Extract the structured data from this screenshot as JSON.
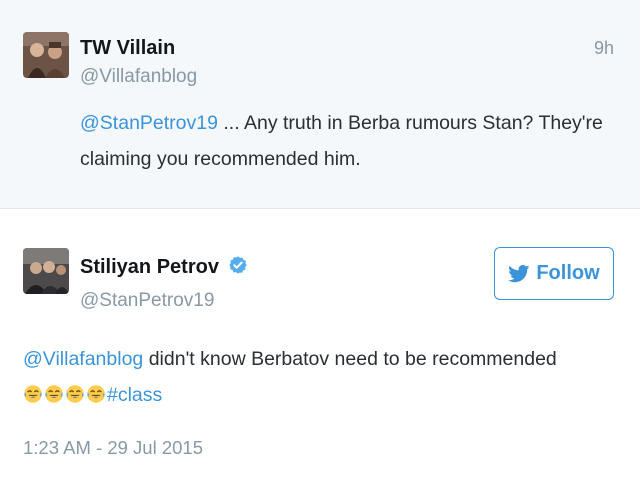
{
  "reply_tweet": {
    "name": "TW Villain",
    "handle": "@Villafanblog",
    "time": "9h",
    "mention": "@StanPetrov19",
    "text_line1": " ... Any truth in Berba rumours Stan? They're",
    "text_line2": "claiming you recommended him."
  },
  "main_tweet": {
    "name": "Stiliyan Petrov",
    "handle": "@StanPetrov19",
    "follow_label": "Follow",
    "mention": "@Villafanblog",
    "text_line1": " didn't know Berbatov need to be recommended",
    "emoji_names": [
      "face-with-tears-of-joy-icon",
      "face-with-tears-of-joy-icon",
      "face-with-tears-of-joy-icon",
      "face-with-tears-of-joy-icon"
    ],
    "hashtag": "#class",
    "timestamp": "1:23 AM - 29 Jul 2015"
  },
  "colors": {
    "link": "#3b94d9",
    "muted": "#8899a6",
    "reply_background": "#f5f8fa",
    "verified_badge": "#55acee"
  }
}
